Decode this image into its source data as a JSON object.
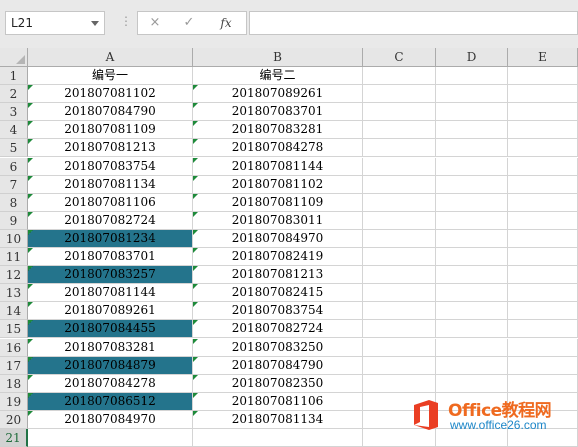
{
  "namebox": {
    "value": "L21"
  },
  "formula": {
    "fx_label": "fx",
    "cancel_icon": "×",
    "enter_icon": "✓",
    "value": ""
  },
  "columns": [
    "A",
    "B",
    "C",
    "D",
    "E"
  ],
  "rows": [
    {
      "num": "1",
      "a": "编号一",
      "b": "编号二",
      "hl": false
    },
    {
      "num": "2",
      "a": "201807081102",
      "b": "201807089261",
      "hl": false
    },
    {
      "num": "3",
      "a": "201807084790",
      "b": "201807083701",
      "hl": false
    },
    {
      "num": "4",
      "a": "201807081109",
      "b": "201807083281",
      "hl": false
    },
    {
      "num": "5",
      "a": "201807081213",
      "b": "201807084278",
      "hl": false
    },
    {
      "num": "6",
      "a": "201807083754",
      "b": "201807081144",
      "hl": false
    },
    {
      "num": "7",
      "a": "201807081134",
      "b": "201807081102",
      "hl": false
    },
    {
      "num": "8",
      "a": "201807081106",
      "b": "201807081109",
      "hl": false
    },
    {
      "num": "9",
      "a": "201807082724",
      "b": "201807083011",
      "hl": false
    },
    {
      "num": "10",
      "a": "201807081234",
      "b": "201807084970",
      "hl": true
    },
    {
      "num": "11",
      "a": "201807083701",
      "b": "201807082419",
      "hl": false
    },
    {
      "num": "12",
      "a": "201807083257",
      "b": "201807081213",
      "hl": true
    },
    {
      "num": "13",
      "a": "201807081144",
      "b": "201807082415",
      "hl": false
    },
    {
      "num": "14",
      "a": "201807089261",
      "b": "201807083754",
      "hl": false
    },
    {
      "num": "15",
      "a": "201807084455",
      "b": "201807082724",
      "hl": true
    },
    {
      "num": "16",
      "a": "201807083281",
      "b": "201807083250",
      "hl": false
    },
    {
      "num": "17",
      "a": "201807084879",
      "b": "201807084790",
      "hl": true
    },
    {
      "num": "18",
      "a": "201807084278",
      "b": "201807082350",
      "hl": false
    },
    {
      "num": "19",
      "a": "201807086512",
      "b": "201807081106",
      "hl": true
    },
    {
      "num": "20",
      "a": "201807084970",
      "b": "201807081134",
      "hl": false
    },
    {
      "num": "21",
      "a": "",
      "b": "",
      "hl": false
    }
  ],
  "watermark": {
    "title": "Office教程网",
    "url": "www.office26.com"
  },
  "colors": {
    "highlight": "#2f99b8",
    "error_triangle": "#1e8a3a",
    "logo_orange": "#ef6a20",
    "logo_blue": "#1c86c8",
    "selection": "#217346"
  }
}
